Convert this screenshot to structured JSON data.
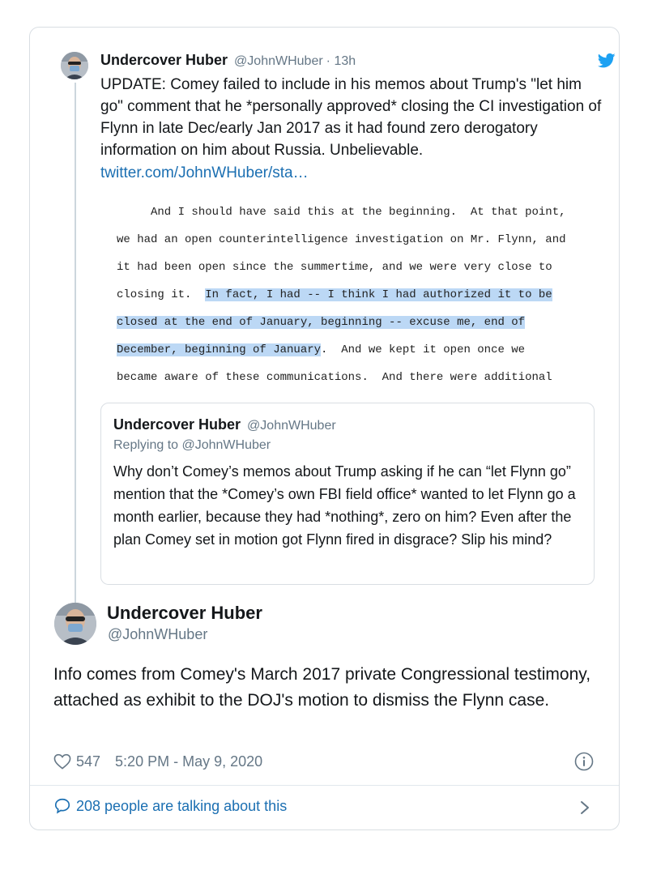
{
  "parent_tweet": {
    "name": "Undercover Huber",
    "handle": "@JohnWHuber",
    "time": "· 13h",
    "text": "UPDATE: Comey failed to include in his memos about Trump's \"let him go\" comment that he *personally approved* closing the CI investigation of Flynn in late Dec/early Jan 2017 as it had found zero derogatory information on him about Russia. Unbelievable.",
    "link": "twitter.com/JohnWHuber/sta…",
    "document_lines": [
      {
        "pre": "     And I should have said this at the beginning.  At that point,",
        "hl": "",
        "post": ""
      },
      {
        "pre": "we had an open counterintelligence investigation on Mr. Flynn, and",
        "hl": "",
        "post": ""
      },
      {
        "pre": "it had been open since the summertime, and we were very close to",
        "hl": "",
        "post": ""
      },
      {
        "pre": "closing it.  ",
        "hl": "In fact, I had -- I think I had authorized it to be",
        "post": ""
      },
      {
        "pre": "",
        "hl": "closed at the end of January, beginning -- excuse me, end of",
        "post": ""
      },
      {
        "pre": "",
        "hl": "December, beginning of January",
        "post": ".  And we kept it open once we"
      },
      {
        "pre": "became aware of these communications.  And there were additional",
        "hl": "",
        "post": ""
      }
    ]
  },
  "quoted_tweet": {
    "name": "Undercover Huber",
    "handle": "@JohnWHuber",
    "replying_to": "Replying to @JohnWHuber",
    "text": "Why don’t Comey’s memos about Trump asking if he can “let Flynn go” mention that the *Comey’s own FBI field office* wanted to let Flynn go a month earlier, because they had *nothing*, zero on him? Even after the plan Comey set in motion got Flynn fired in disgrace? Slip his mind?"
  },
  "main_tweet": {
    "name": "Undercover Huber",
    "handle": "@JohnWHuber",
    "text": "Info comes from Comey's March 2017 private Congressional testimony, attached as exhibit to the DOJ's motion to dismiss the Flynn case.",
    "likes": "547",
    "timestamp": "5:20 PM - May 9, 2020",
    "talking": "208 people are talking about this"
  },
  "colors": {
    "link": "#1b6fb2",
    "twitter_blue": "#1da1f2",
    "secondary_text": "#657786",
    "highlight": "#bcd8f5"
  },
  "icons": [
    "twitter-bird-icon",
    "heart-icon",
    "info-icon",
    "reply-bubble-icon",
    "chevron-right-icon"
  ]
}
